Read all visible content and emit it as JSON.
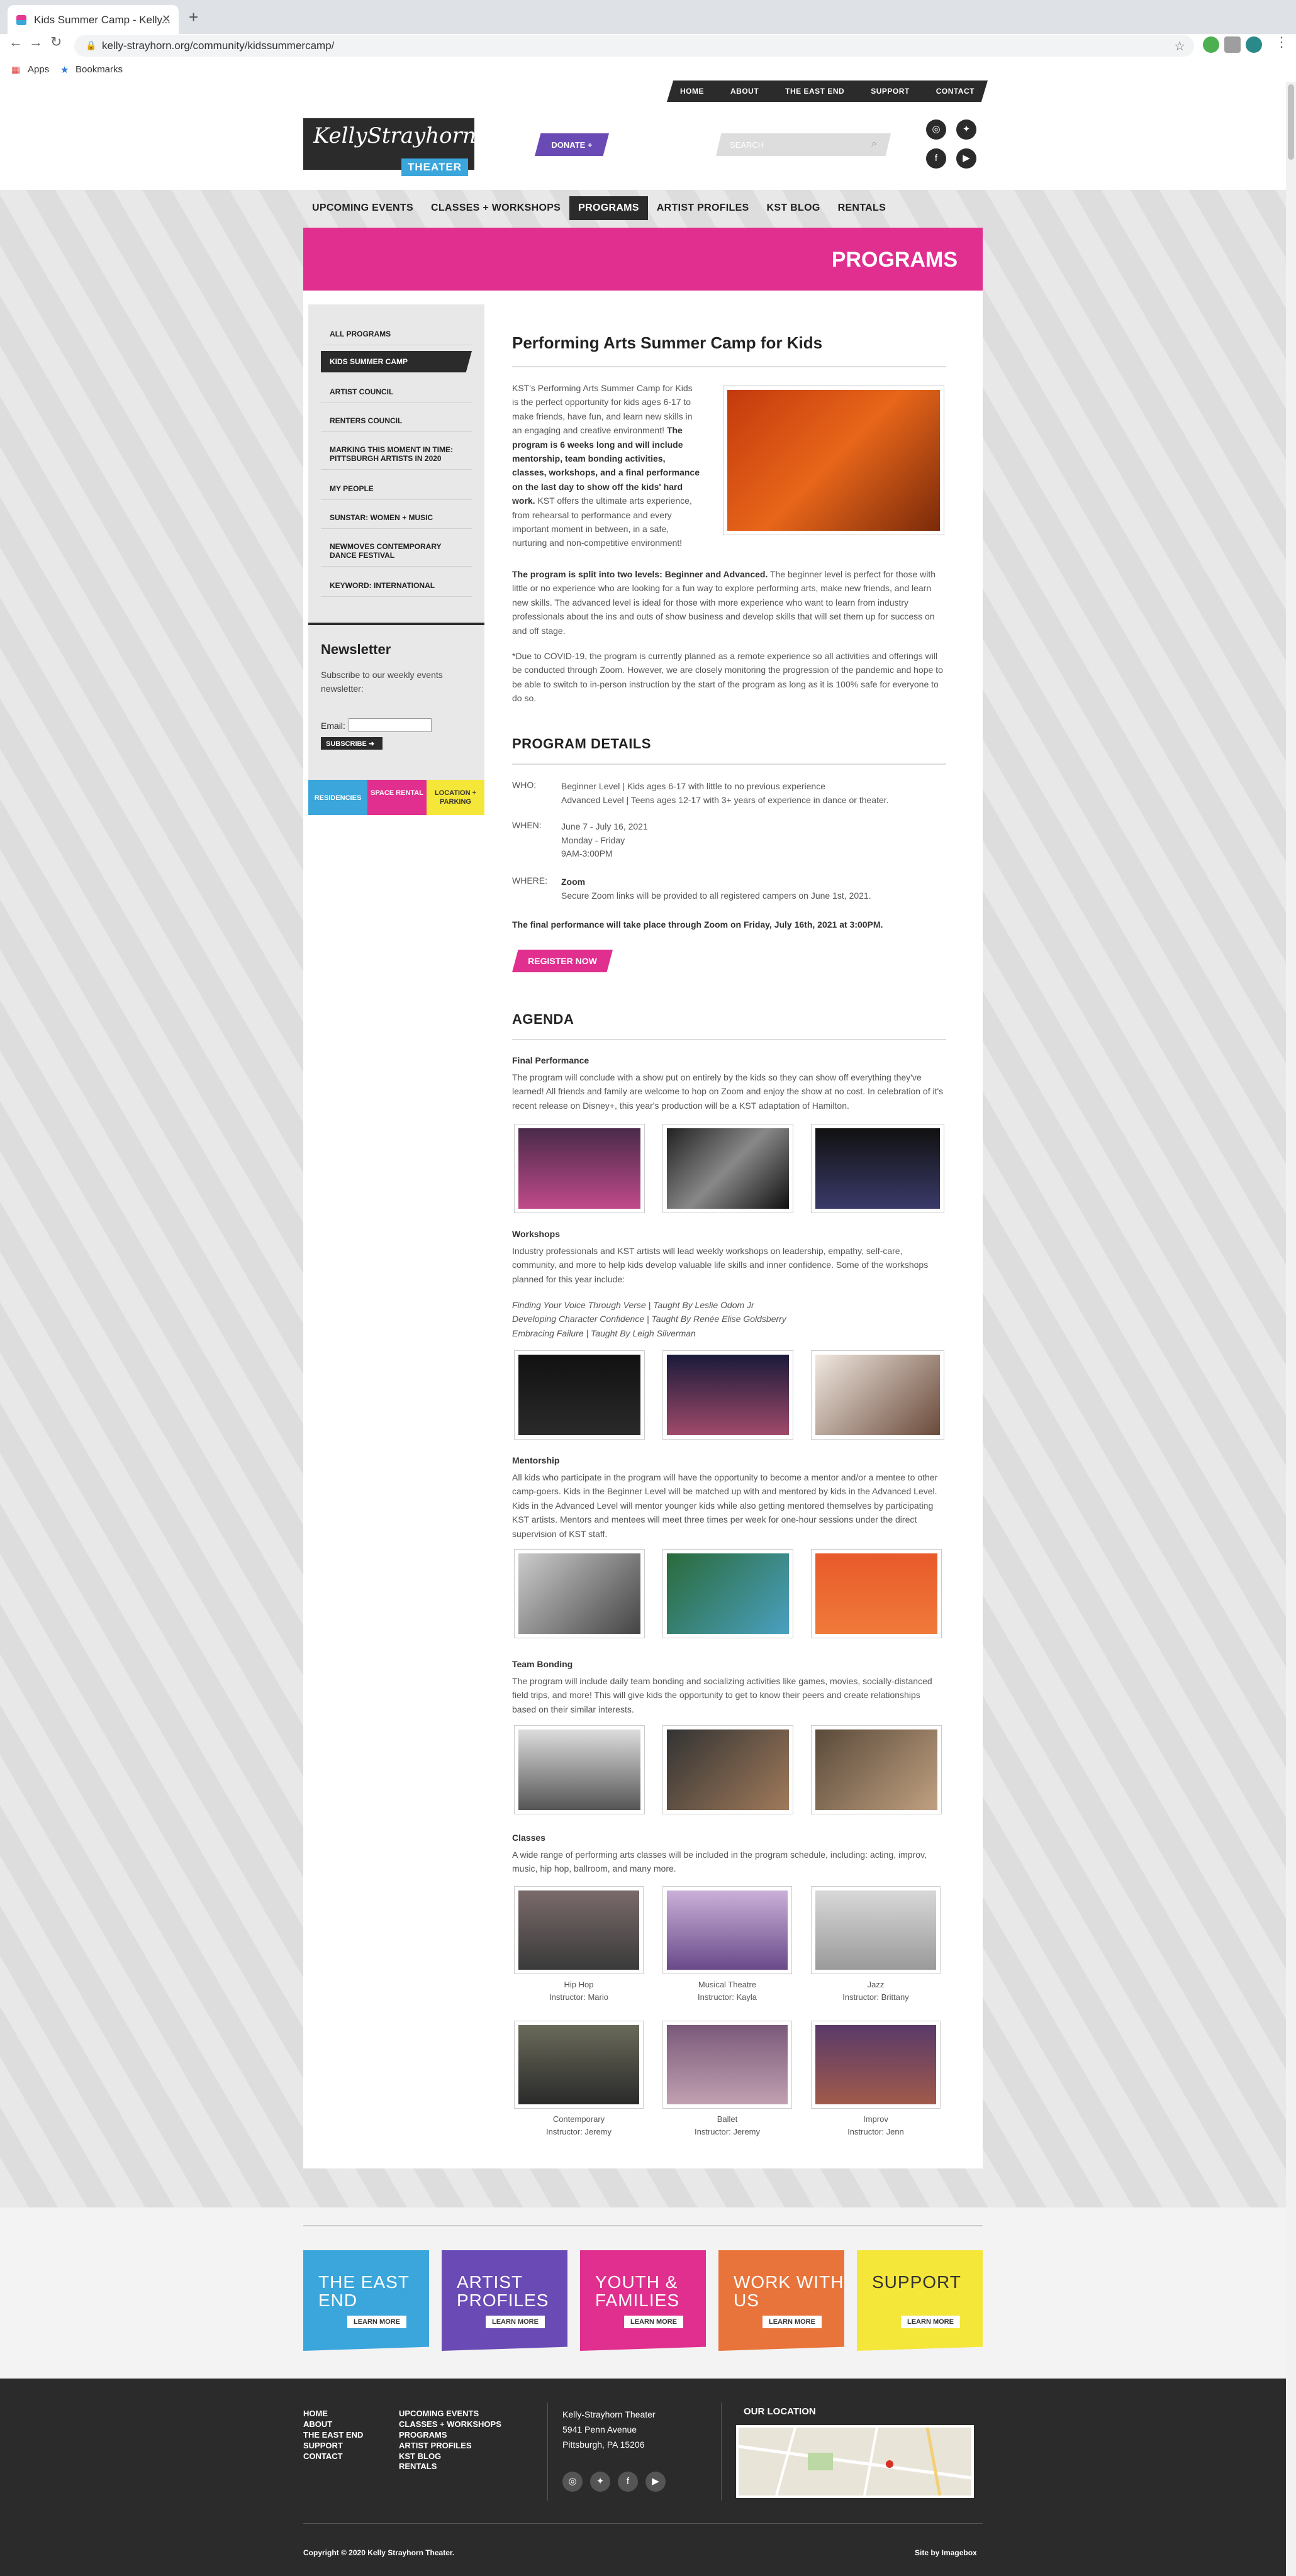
{
  "browser": {
    "tab_title": "Kids Summer Camp - Kelly...",
    "url": "kelly-strayhorn.org/community/kidssummercamp/",
    "bookmarks": [
      "Apps",
      "Bookmarks"
    ]
  },
  "header": {
    "top_nav": [
      "HOME",
      "ABOUT",
      "THE EAST END",
      "SUPPORT",
      "CONTACT"
    ],
    "logo_script": "KellyStrayhorn",
    "logo_theater": "THEATER",
    "donate": "DONATE",
    "search_placeholder": "SEARCH"
  },
  "main_nav": [
    "UPCOMING EVENTS",
    "CLASSES + WORKSHOPS",
    "PROGRAMS",
    "ARTIST PROFILES",
    "KST BLOG",
    "RENTALS"
  ],
  "banner_title": "PROGRAMS",
  "sidebar": {
    "items": [
      "ALL PROGRAMS",
      "KIDS SUMMER CAMP",
      "ARTIST COUNCIL",
      "RENTERS COUNCIL",
      "MARKING THIS MOMENT IN TIME: PITTSBURGH ARTISTS IN 2020",
      "MY PEOPLE",
      "SUNSTAR: WOMEN + MUSIC",
      "NEWMOVES CONTEMPORARY DANCE FESTIVAL",
      "KEYWORD: INTERNATIONAL"
    ],
    "newsletter_title": "Newsletter",
    "newsletter_text": "Subscribe to our weekly events newsletter:",
    "email_label": "Email:",
    "subscribe": "SUBSCRIBE",
    "tiles": [
      "RESIDENCIES",
      "SPACE RENTAL",
      "LOCATION + PARKING"
    ]
  },
  "article": {
    "title": "Performing Arts Summer Camp for Kids",
    "intro_a": "KST's Performing Arts Summer Camp for Kids is the perfect opportunity for kids ages 6-17 to make friends, have fun, and learn new skills in an engaging and creative environment!",
    "intro_b": "The program is 6 weeks long and will include mentorship, team bonding activities, classes, workshops, and a final performance on the last day to show off the kids' hard work.",
    "intro_c": "KST offers the ultimate arts experience, from rehearsal to performance and every important moment in between, in a safe, nurturing and non-competitive environment!",
    "levels_bold": "The program is split into two levels: Beginner and Advanced.",
    "levels_text": "The beginner level is perfect for those with little or no experience who are looking for a fun way to explore performing arts, make new friends, and learn new skills. The advanced level is ideal for those with more experience who want to learn from industry professionals about the ins and outs of show business and develop skills that will set them up for success on and off stage.",
    "covid": "*Due to COVID-19, the program is currently planned as a remote experience so all activities and offerings will be conducted through Zoom. However, we are closely monitoring the progression of the pandemic and hope to be able to switch to in-person instruction by the start of the program as long as it is 100% safe for everyone to do so.",
    "details_heading": "PROGRAM DETAILS",
    "who_label": "WHO:",
    "who_1": "Beginner Level | Kids ages 6-17 with little to no previous experience",
    "who_2": "Advanced Level | Teens ages 12-17 with 3+ years of experience in dance or theater.",
    "when_label": "WHEN:",
    "when_1": "June 7 - July 16, 2021",
    "when_2": "Monday - Friday",
    "when_3": "9AM-3:00PM",
    "where_label": "WHERE:",
    "where_1": "Zoom",
    "where_2": "Secure Zoom links will be provided to all registered campers on June 1st, 2021.",
    "final_note": "The final performance will take place through Zoom on Friday, July 16th, 2021 at 3:00PM.",
    "register": "REGISTER NOW",
    "agenda_heading": "AGENDA",
    "final_perf_title": "Final Performance",
    "final_perf_text": "The program will conclude with a show put on entirely by the kids so they can show off everything they've learned! All friends and family are welcome to hop on Zoom and enjoy the show at no cost. In celebration of it's recent release on Disney+, this year's production will be a KST adaptation of Hamilton.",
    "workshops_title": "Workshops",
    "workshops_text": "Industry professionals and KST artists will lead weekly workshops on leadership, empathy, self-care, community, and more to help kids develop valuable life skills and inner confidence. Some of the workshops planned for this year include:",
    "workshop_1": "Finding Your Voice Through Verse | Taught By Leslie Odom Jr",
    "workshop_2": "Developing Character Confidence | Taught By Renée Elise Goldsberry",
    "workshop_3": "Embracing Failure | Taught By Leigh Silverman",
    "mentorship_title": "Mentorship",
    "mentorship_text": "All kids who participate in the program will have the opportunity to become a mentor and/or a mentee to other camp-goers. Kids in the Beginner Level will be matched up with and mentored by kids in the Advanced Level. Kids in the Advanced Level will mentor younger kids while also getting mentored themselves by participating KST artists. Mentors and mentees will meet three times per week for one-hour sessions under the direct supervision of KST staff.",
    "team_title": "Team Bonding",
    "team_text": "The program will include daily team bonding and socializing activities like games, movies, socially-distanced field trips, and more! This will give kids the opportunity to get to know their peers and create relationships based on their similar interests.",
    "classes_title": "Classes",
    "classes_text": "A wide range of performing arts classes will be included in the program schedule, including: acting, improv, music, hip hop, ballroom, and many more.",
    "classes": [
      {
        "name": "Hip Hop",
        "instructor": "Instructor: Mario"
      },
      {
        "name": "Musical Theatre",
        "instructor": "Instructor: Kayla"
      },
      {
        "name": "Jazz",
        "instructor": "Instructor: Brittany"
      },
      {
        "name": "Contemporary",
        "instructor": "Instructor: Jeremy"
      },
      {
        "name": "Ballet",
        "instructor": "Instructor: Jeremy"
      },
      {
        "name": "Improv",
        "instructor": "Instructor: Jenn"
      }
    ]
  },
  "footer_tiles": [
    {
      "title": "THE EAST END",
      "button": "LEARN MORE",
      "color": "#3aa6db"
    },
    {
      "title": "ARTIST PROFILES",
      "button": "LEARN MORE",
      "color": "#6a4bb5"
    },
    {
      "title": "YOUTH & FAMILIES",
      "button": "LEARN MORE",
      "color": "#e02f8f"
    },
    {
      "title": "WORK WITH US",
      "button": "LEARN MORE",
      "color": "#e8743b"
    },
    {
      "title": "SUPPORT",
      "button": "LEARN MORE",
      "color": "#f5e63a"
    }
  ],
  "footer": {
    "col1": [
      "HOME",
      "ABOUT",
      "THE EAST END",
      "SUPPORT",
      "CONTACT"
    ],
    "col2": [
      "UPCOMING EVENTS",
      "CLASSES + WORKSHOPS",
      "PROGRAMS",
      "ARTIST PROFILES",
      "KST BLOG",
      "RENTALS"
    ],
    "address_1": "Kelly-Strayhorn Theater",
    "address_2": "5941 Penn Avenue",
    "address_3": "Pittsburgh, PA 15206",
    "location_heading": "OUR LOCATION",
    "copyright": "Copyright © 2020 Kelly Strayhorn Theater.",
    "credit": "Site by Imagebox"
  }
}
